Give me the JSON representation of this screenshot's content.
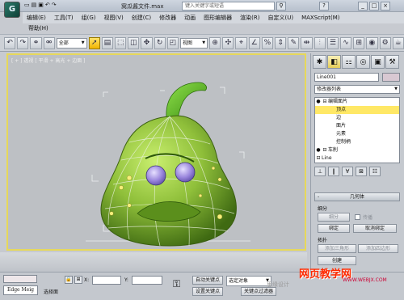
{
  "window": {
    "logo_letter": "G",
    "doc_title": "窝瓜酱文件.max",
    "search_placeholder": "键入关键字或短语",
    "search_icon": "binoculars-icon",
    "controls": [
      "?",
      "_",
      "□",
      "×"
    ]
  },
  "menu": {
    "items": [
      "编辑(E)",
      "工具(T)",
      "组(G)",
      "视图(V)",
      "创建(C)",
      "修改器",
      "动画",
      "图形编辑器",
      "渲染(R)",
      "自定义(U)",
      "MAXScript(M)"
    ],
    "help": "帮助(H)"
  },
  "toolbar": {
    "selection_filter": "全部",
    "ref_coord": "视图",
    "icons": [
      "undo-icon",
      "redo-icon",
      "link-icon",
      "unlink-icon",
      "bind-icon",
      "select-icon",
      "select-by-name-icon",
      "region-select-icon",
      "window-crossing-icon",
      "move-icon",
      "rotate-icon",
      "scale-icon",
      "pivot-icon",
      "select-manipulate-icon",
      "snap-3d-icon",
      "angle-snap-icon",
      "percent-snap-icon",
      "spinner-snap-icon",
      "named-selection-icon",
      "mirror-icon",
      "align-icon",
      "layer-icon",
      "curve-editor-icon",
      "schematic-icon",
      "material-editor-icon",
      "render-setup-icon",
      "render-icon"
    ]
  },
  "viewport": {
    "label": "[ + ] 透视 [ 平滑 + 高光 + 边面 ]"
  },
  "command_panel": {
    "tabs": [
      "create-icon",
      "modify-icon",
      "hierarchy-icon",
      "motion-icon",
      "display-icon",
      "utilities-icon"
    ],
    "object_name": "Line001",
    "modifier_list": "修改器列表",
    "stack": [
      {
        "glyph": "⊟",
        "label": "编辑面片",
        "indent": 0,
        "bulb": true
      },
      {
        "glyph": "",
        "label": "顶点",
        "indent": 2,
        "selected": true
      },
      {
        "glyph": "",
        "label": "边",
        "indent": 2
      },
      {
        "glyph": "",
        "label": "面片",
        "indent": 2
      },
      {
        "glyph": "",
        "label": "元素",
        "indent": 2
      },
      {
        "glyph": "",
        "label": "控制柄",
        "indent": 2
      },
      {
        "glyph": "⊟",
        "label": "车削",
        "indent": 0,
        "bulb": true
      },
      {
        "glyph": "⊟",
        "label": "Line",
        "indent": 0
      },
      {
        "glyph": "",
        "label": "···",
        "indent": 2
      }
    ],
    "geometry": {
      "title": "几何体",
      "sign": "-",
      "subdivide_label": "细分",
      "subdivide_btn": "细分",
      "propagate_label": "传播",
      "topology_label": "拓扑",
      "bind_btn": "绑定",
      "unbind_btn": "取消绑定",
      "add_tri_btn": "添加三角形",
      "add_quad_btn": "添加四边形",
      "create_btn": "创建"
    }
  },
  "status": {
    "edge_label": "Edge Meig",
    "selected_text": "选择面",
    "x_label": "X:",
    "y_label": "Y:",
    "auto_key": "自动关键点",
    "selected_obj": "选定对象",
    "set_key": "设置关键点",
    "key_filter": "关键点过滤器",
    "key_icon": "key-icon"
  },
  "watermark": {
    "site": "思缘设计",
    "brand": "网页教学网",
    "url": "WWW.WEBJX.COM"
  },
  "colors": {
    "viewport_border": "#e7d85a",
    "selection": "#ffe866",
    "model_green": "#8fbf3a",
    "eye_purple": "#9a86dd"
  }
}
